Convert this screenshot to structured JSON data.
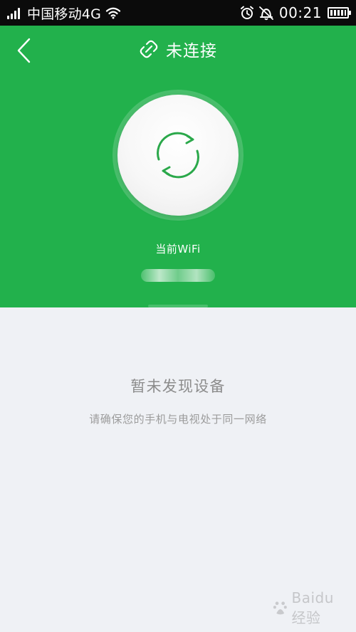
{
  "status_bar": {
    "carrier": "中国移动4G",
    "time": "00:21",
    "icons": [
      "signal-icon",
      "wifi-icon",
      "alarm-icon",
      "vibrate-icon",
      "battery-icon"
    ],
    "battery_level": 1.0
  },
  "header": {
    "title": "未连接",
    "back_icon": "back-chevron-icon",
    "title_icon": "link-broken-icon",
    "action_icon": "refresh-icon",
    "wifi_label": "当前WiFi",
    "wifi_name": ""
  },
  "content": {
    "empty_title": "暂未发现设备",
    "empty_subtitle": "请确保您的手机与电视处于同一网络"
  },
  "watermark": {
    "logo_text": "Baidu经验"
  },
  "colors": {
    "accent": "#22b14c",
    "status_bar": "#0b0b0b",
    "body_background": "#eff1f5",
    "circle_button": "#f7f7f7",
    "icon_green": "#2aa84a",
    "text_muted": "#8c8c8c"
  }
}
